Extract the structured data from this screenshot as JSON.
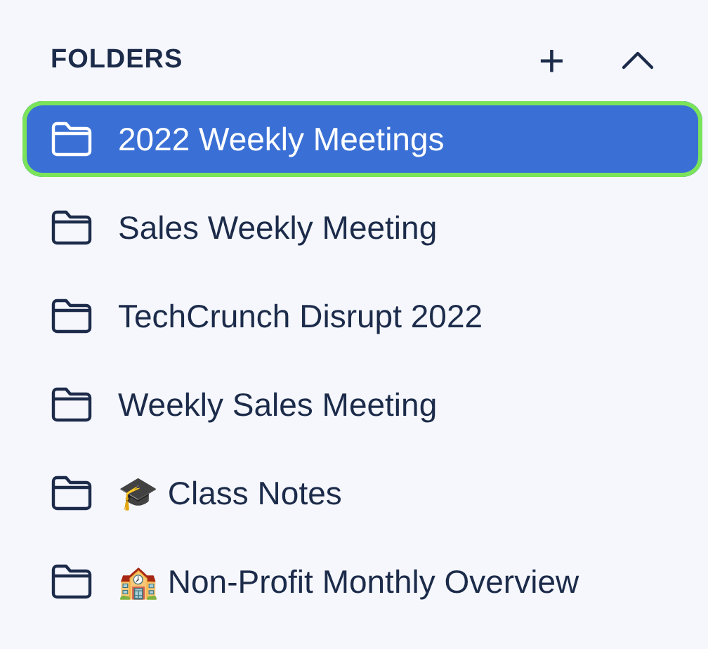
{
  "header": {
    "title": "FOLDERS",
    "add_label": "+"
  },
  "folders": [
    {
      "label": "2022 Weekly Meetings",
      "selected": true
    },
    {
      "label": "Sales Weekly Meeting",
      "selected": false
    },
    {
      "label": "TechCrunch Disrupt 2022",
      "selected": false
    },
    {
      "label": "Weekly Sales Meeting",
      "selected": false
    },
    {
      "label": "🎓 Class Notes",
      "selected": false
    },
    {
      "label": "🏫 Non-Profit Monthly Overview",
      "selected": false
    }
  ]
}
